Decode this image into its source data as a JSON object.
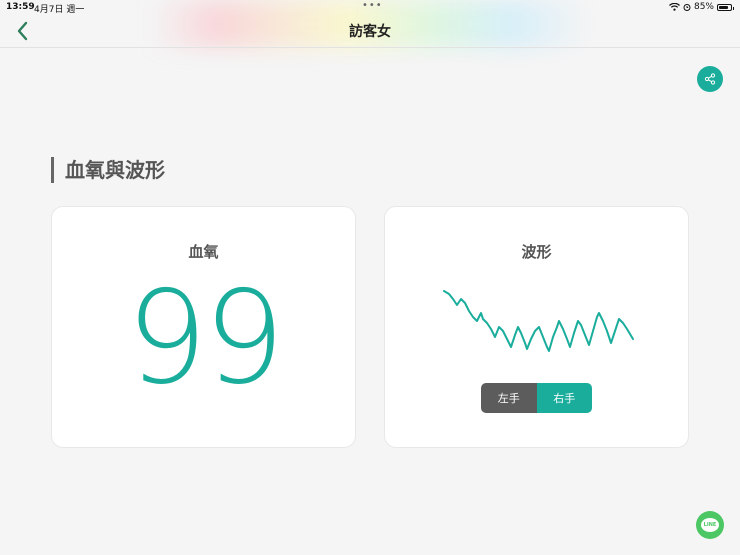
{
  "status": {
    "time": "13:59",
    "date": "4月7日 週一",
    "battery": "85%",
    "battery_level": 0.85,
    "dots": "•••"
  },
  "nav": {
    "title": "訪客女",
    "back_icon": "chevron-left-icon"
  },
  "share": {
    "icon": "share-icon"
  },
  "section": {
    "title": "血氧與波形"
  },
  "spo2_card": {
    "title": "血氧",
    "value": "99"
  },
  "wave_card": {
    "title": "波形",
    "toggle": {
      "left_label": "左手",
      "right_label": "右手",
      "selected": "右手"
    }
  },
  "line_button": {
    "label": "LINE",
    "icon": "line-icon"
  },
  "colors": {
    "accent": "#1aad9c",
    "toggle_inactive": "#5c5c5c",
    "line_green": "#4cc764"
  }
}
